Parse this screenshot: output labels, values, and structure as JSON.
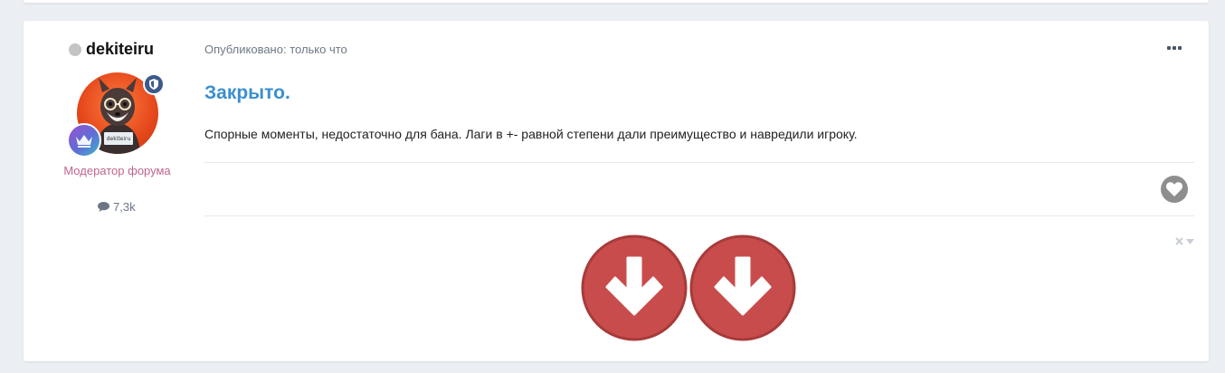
{
  "author": {
    "name": "dekiteiru",
    "group": "Модератор форума",
    "post_count": "7,3k",
    "avatar_sign": "dekiteiru"
  },
  "post": {
    "meta": "Опубликовано: только что",
    "title": "Закрыто.",
    "body": "Спорные моменты, недостаточно для бана. Лаги в +- равной степени дали преимущество и навредили игроку."
  },
  "icons": {
    "online": "offline-dot-icon",
    "moderator": "shield-icon",
    "rank": "crown-icon",
    "posts": "comment-icon",
    "menu": "more-horizontal-icon",
    "like": "heart-icon",
    "signature_toggle": "close-icon",
    "signature_dropdown": "chevron-down-icon",
    "signature_image": "arrow-down-icon"
  },
  "colors": {
    "title": "#3a8fd0",
    "group": "#c0648e",
    "arrow_circle": "#c94c4c",
    "page_bg": "#ebeef2"
  }
}
